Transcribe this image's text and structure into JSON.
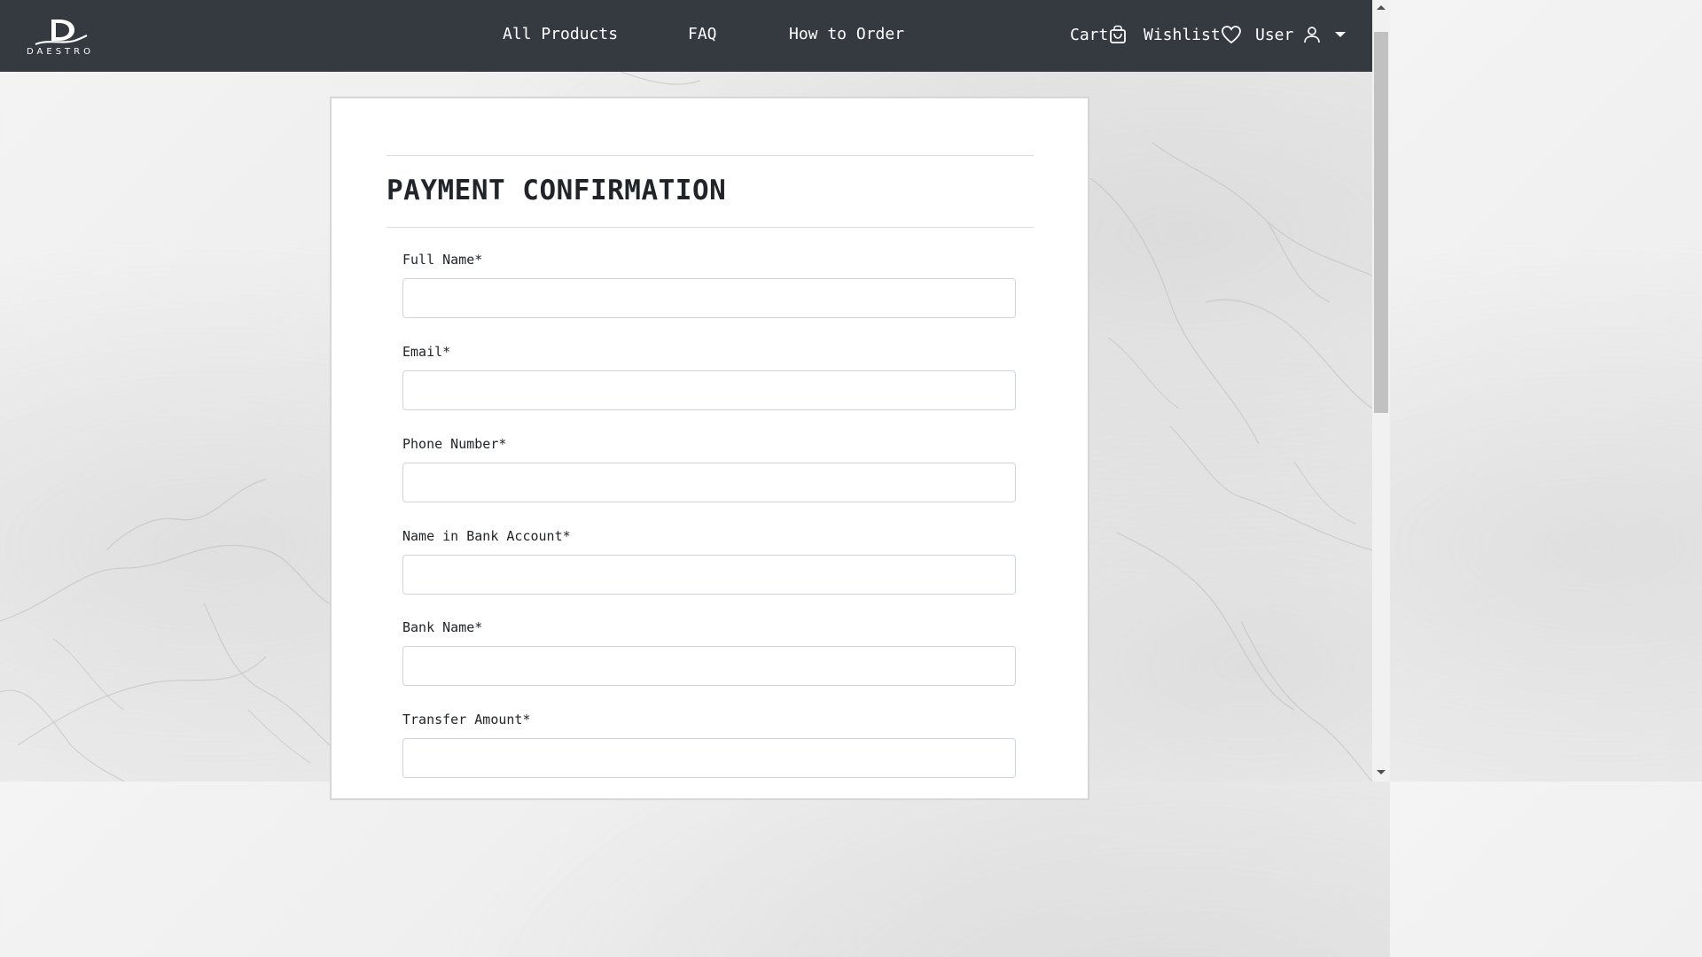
{
  "brand": {
    "logo_letter": "D",
    "logo_word": "DAESTRO"
  },
  "nav": {
    "links": [
      "All Products",
      "FAQ",
      "How to Order"
    ],
    "cart_label": "Cart",
    "wishlist_label": "Wishlist",
    "user_label": "User"
  },
  "icons": {
    "cart": "shopping-bag-icon",
    "wishlist": "heart-icon",
    "user": "user-icon",
    "dropdown": "caret-down-icon"
  },
  "colors": {
    "navbar": "#343a40",
    "card_border": "#d6d6d6",
    "input_border": "#ced4da",
    "text": "#212529"
  },
  "form": {
    "title": "PAYMENT CONFIRMATION",
    "fields": [
      {
        "label": "Full Name*",
        "value": ""
      },
      {
        "label": "Email*",
        "value": ""
      },
      {
        "label": "Phone Number*",
        "value": ""
      },
      {
        "label": "Name in Bank Account*",
        "value": ""
      },
      {
        "label": "Bank Name*",
        "value": ""
      },
      {
        "label": "Transfer Amount*",
        "value": ""
      }
    ]
  }
}
